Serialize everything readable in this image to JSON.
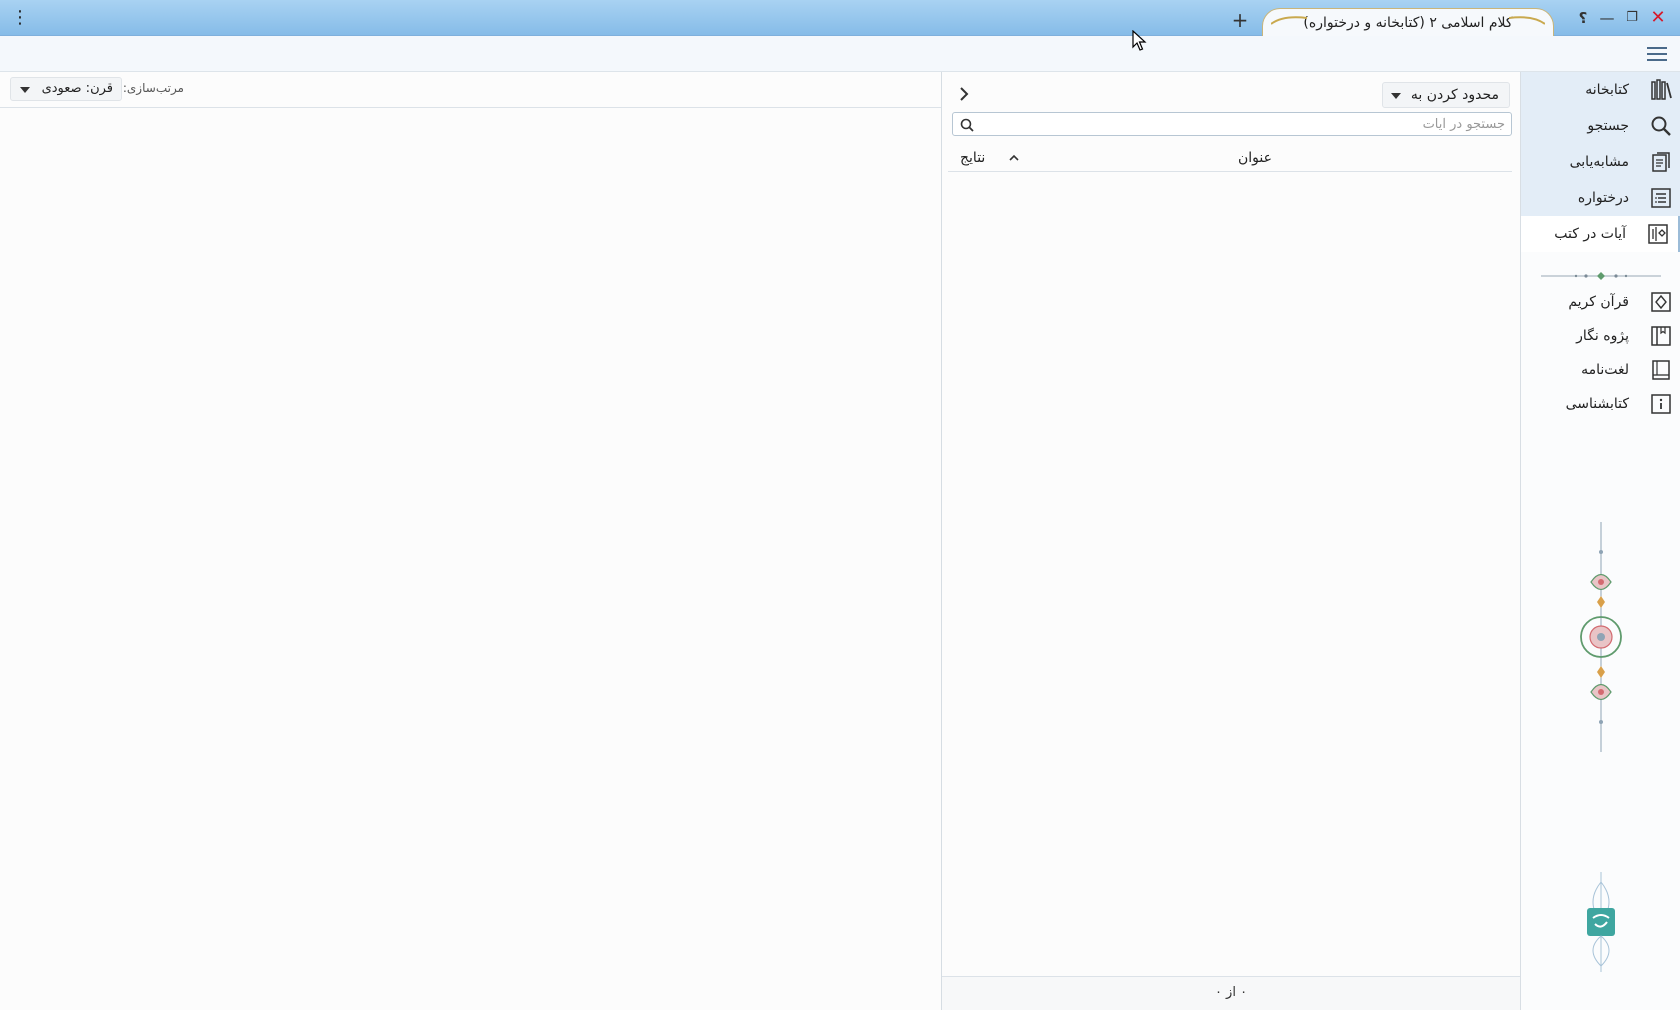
{
  "window": {
    "tab_title": "کلام اسلامی ۲ (کتابخانه و درختواره)",
    "add_tab": "+",
    "menu_dots": "⋮",
    "help": "؟",
    "minimize": "—",
    "maximize": "❐",
    "close": "✕"
  },
  "sidebar": {
    "items": [
      {
        "label": "کتابخانه",
        "icon": "library-icon"
      },
      {
        "label": "جستجو",
        "icon": "search-icon"
      },
      {
        "label": "مشابه‌یابی",
        "icon": "similar-docs-icon"
      },
      {
        "label": "درختواره",
        "icon": "tree-list-icon"
      },
      {
        "label": "آیات در کتب",
        "icon": "verses-in-books-icon"
      }
    ],
    "sub_items": [
      {
        "label": "قرآن کریم",
        "icon": "quran-icon"
      },
      {
        "label": "پژوه نگار",
        "icon": "notebook-icon"
      },
      {
        "label": "لغت‌نامه",
        "icon": "dictionary-icon"
      },
      {
        "label": "کتابشناسی",
        "icon": "info-book-icon"
      }
    ]
  },
  "middle": {
    "restrict_label": "محدود کردن به",
    "search_placeholder": "جستجو در آیات",
    "col_title": "عنوان",
    "col_results": "نتایج",
    "count": "۰ از ۰"
  },
  "left": {
    "sort_label": "مرتب‌سازی:",
    "sort_value": "قرن: صعودی"
  },
  "colors": {
    "titlebar": "#86bce8",
    "accent": "#9cbcd8",
    "close": "#d6192b"
  }
}
